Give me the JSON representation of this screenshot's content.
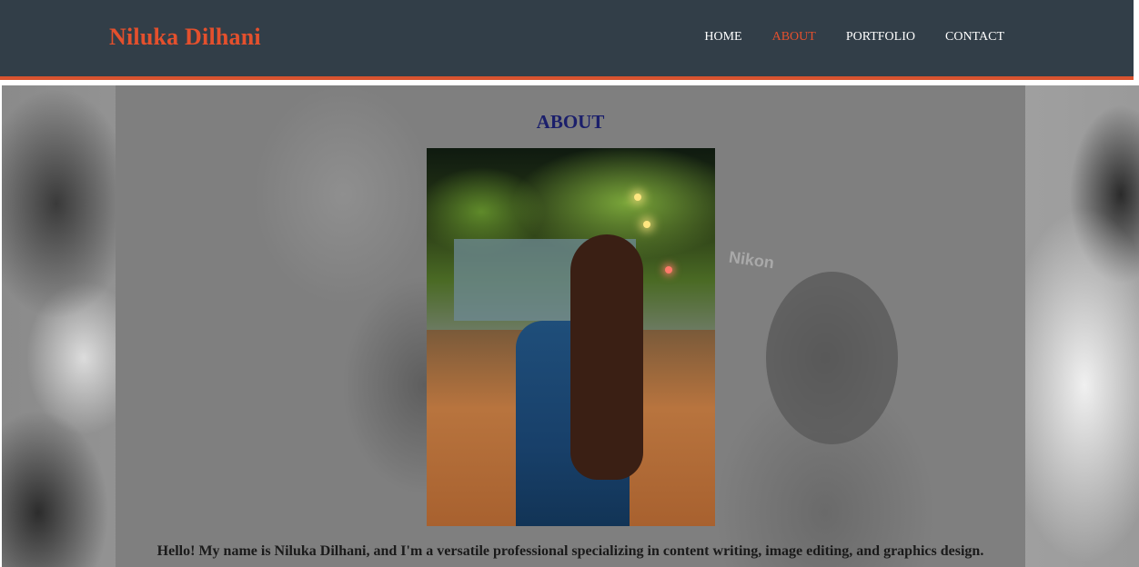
{
  "header": {
    "brand": "Niluka Dilhani",
    "nav": [
      {
        "label": "HOME",
        "active": false
      },
      {
        "label": "ABOUT",
        "active": true
      },
      {
        "label": "PORTFOLIO",
        "active": false
      },
      {
        "label": "CONTACT",
        "active": false
      }
    ]
  },
  "about": {
    "title": "ABOUT",
    "background_text": "Nikon",
    "bio": "Hello! My name is Niluka Dilhani, and I'm a versatile professional specializing in content writing, image editing, and graphics design."
  },
  "colors": {
    "accent": "#e4502d",
    "header_bg": "#323e48",
    "title": "#1b1f6b"
  }
}
